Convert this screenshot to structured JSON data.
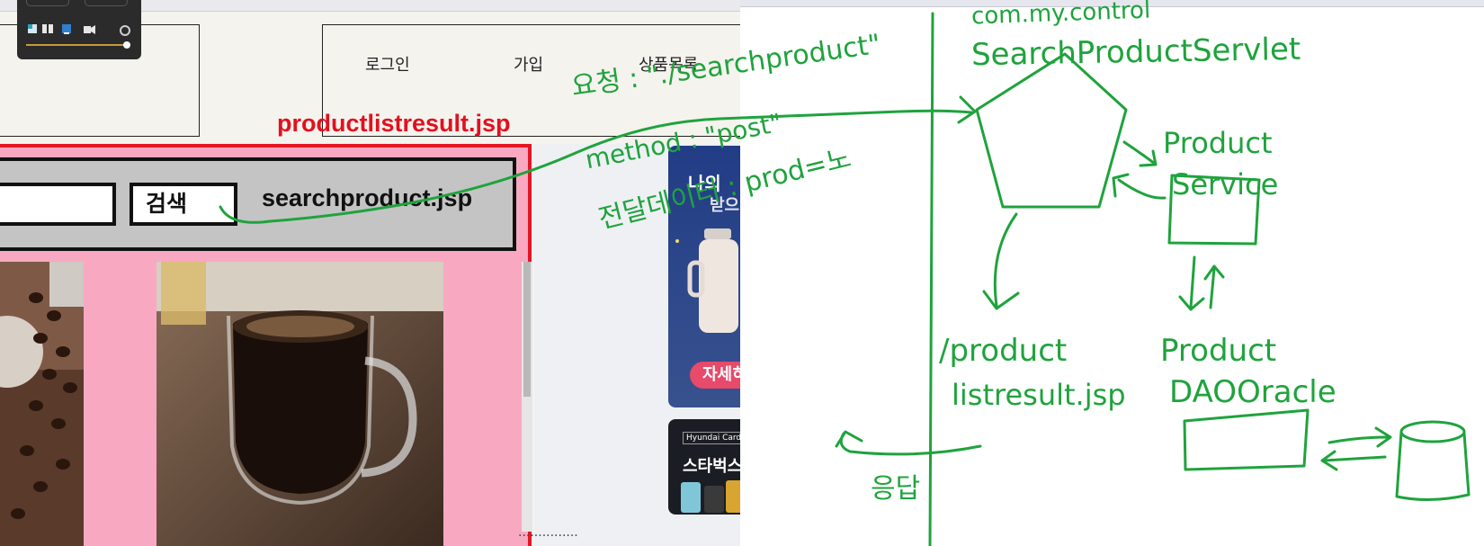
{
  "site_nav": {
    "login": "로그인",
    "signup": "가입",
    "product_list": "상품목록"
  },
  "file_label": "productlistresult.jsp",
  "search": {
    "input_value": "",
    "button_label": "검색",
    "file_note": "searchproduct.jsp"
  },
  "ads": {
    "ad1_title": "나의",
    "ad1_subtitle": "받으",
    "ad1_button": "자세히",
    "ad2_brand": "Hyundai Card",
    "ad2_title": "스타벅스"
  },
  "bottom_text": "...............",
  "annotations": {
    "request": "요청 : \"./searchproduct\"",
    "method": "method : \"post\"",
    "params": "전달데이터 : prod=노",
    "package": "com.my.control",
    "servlet": "SearchProductServlet",
    "service_line1": "Product",
    "service_line2": "Service",
    "result_line1": "/product",
    "result_line2": "listresult.jsp",
    "dao_line1": "Product",
    "dao_line2": "DAOOracle",
    "response": "응답"
  },
  "colors": {
    "annotation_green": "#1fa33d",
    "frame_red": "#e51624",
    "result_pink": "#f8a9c1",
    "searchbar_gray": "#c4c4c4"
  }
}
